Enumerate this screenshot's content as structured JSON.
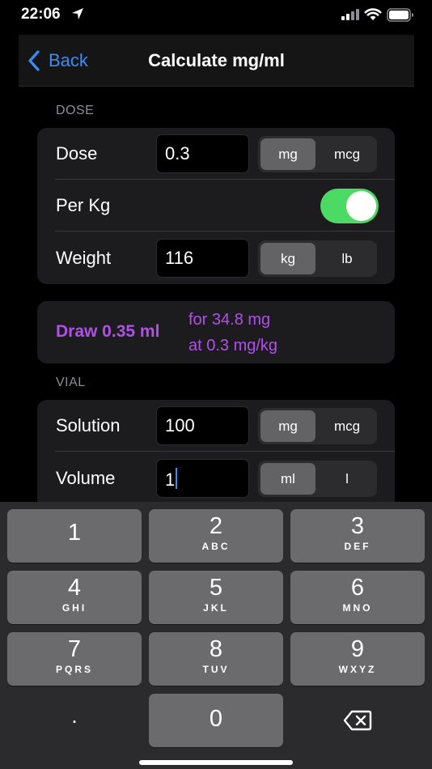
{
  "status_bar": {
    "time": "22:06"
  },
  "nav": {
    "back_label": "Back",
    "title": "Calculate mg/ml"
  },
  "dose_section": {
    "header": "DOSE",
    "dose": {
      "label": "Dose",
      "value": "0.3",
      "units": [
        "mg",
        "mcg"
      ],
      "selected_unit": "mg"
    },
    "per_kg": {
      "label": "Per Kg",
      "enabled": true
    },
    "weight": {
      "label": "Weight",
      "value": "116",
      "units": [
        "kg",
        "lb"
      ],
      "selected_unit": "kg"
    }
  },
  "result": {
    "main": "Draw 0.35 ml",
    "line1": "for 34.8 mg",
    "line2": "at 0.3 mg/kg",
    "color": "#b150e8"
  },
  "vial_section": {
    "header": "VIAL",
    "solution": {
      "label": "Solution",
      "value": "100",
      "units": [
        "mg",
        "mcg"
      ],
      "selected_unit": "mg"
    },
    "volume": {
      "label": "Volume",
      "value": "1",
      "units": [
        "ml",
        "l"
      ],
      "selected_unit": "ml"
    }
  },
  "keyboard": {
    "keys": [
      {
        "num": "1",
        "letters": ""
      },
      {
        "num": "2",
        "letters": "ABC"
      },
      {
        "num": "3",
        "letters": "DEF"
      },
      {
        "num": "4",
        "letters": "GHI"
      },
      {
        "num": "5",
        "letters": "JKL"
      },
      {
        "num": "6",
        "letters": "MNO"
      },
      {
        "num": "7",
        "letters": "PQRS"
      },
      {
        "num": "8",
        "letters": "TUV"
      },
      {
        "num": "9",
        "letters": "WXYZ"
      },
      {
        "num": "0",
        "letters": ""
      }
    ],
    "decimal": ".",
    "delete_icon": "backspace-icon"
  },
  "colors": {
    "accent": "#3b8cf5",
    "toggle_on": "#4cd964",
    "result": "#b150e8"
  }
}
